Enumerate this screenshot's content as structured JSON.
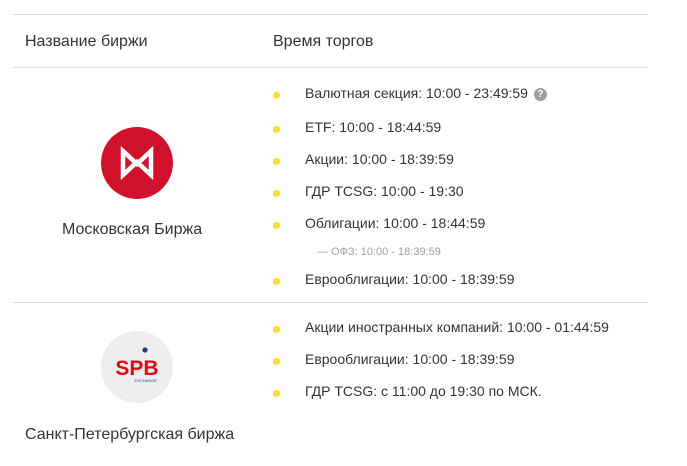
{
  "header": {
    "col_exchange": "Название биржи",
    "col_hours": "Время торгов"
  },
  "exchanges": [
    {
      "name": "Московская Биржа",
      "logo_icon": "moex-logo-icon",
      "logo_color": "#d0112b",
      "items": [
        "Валютная секция: 10:00 - 23:49:59",
        "ETF: 10:00 - 18:44:59",
        "Акции: 10:00 - 18:39:59",
        "ГДР TCSG: 10:00 - 19:30",
        "Облигации: 10:00 - 18:44:59",
        "Еврооблигации: 10:00 - 18:39:59"
      ],
      "sub_note": "— ОФЗ: 10:00 - 18:39:59",
      "help_icon": "question-circle-icon",
      "help_glyph": "?"
    },
    {
      "name": "Санкт-Петербургская биржа",
      "logo_icon": "spb-exchange-logo-icon",
      "logo_text": "SPB",
      "logo_subtext": "EXCHANGE",
      "items": [
        "Акции иностранных компаний: 10:00 - 01:44:59",
        "Еврооблигации: 10:00 - 18:39:59",
        "ГДР TCSG: с 11:00 до 19:30 по МСК."
      ]
    }
  ],
  "colors": {
    "bullet": "#ffdd2d",
    "divider": "#dddddd",
    "muted_text": "#9e9e9e",
    "spb_red": "#e30613",
    "spb_blue": "#1d3f8f"
  }
}
